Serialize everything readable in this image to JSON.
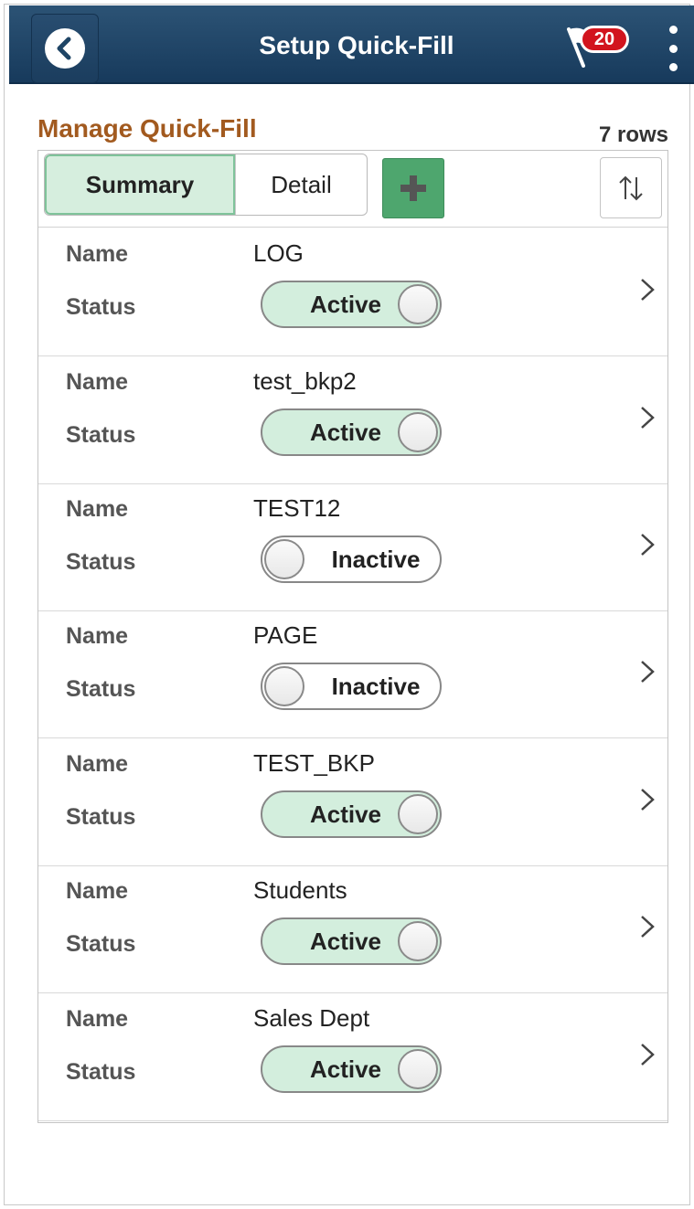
{
  "header": {
    "title": "Setup Quick-Fill",
    "notification_count": "20"
  },
  "section": {
    "title": "Manage Quick-Fill",
    "row_count": "7 rows"
  },
  "toolbar": {
    "view_tabs": [
      "Summary",
      "Detail"
    ],
    "selected_view": "Summary"
  },
  "labels": {
    "name": "Name",
    "status": "Status"
  },
  "rows": [
    {
      "name": "LOG",
      "status": "Active"
    },
    {
      "name": "test_bkp2",
      "status": "Active"
    },
    {
      "name": "TEST12",
      "status": "Inactive"
    },
    {
      "name": "PAGE",
      "status": "Inactive"
    },
    {
      "name": "TEST_BKP",
      "status": "Active"
    },
    {
      "name": "Students",
      "status": "Active"
    },
    {
      "name": "Sales Dept",
      "status": "Active"
    }
  ],
  "icons": {
    "back": "chevron-left-icon",
    "notifications": "flag-icon",
    "menu": "kebab-menu-icon",
    "add": "plus-icon",
    "sort": "sort-arrows-icon",
    "row_action": "chevron-right-icon"
  },
  "colors": {
    "header": "#1f4566",
    "section_title": "#a25a1f",
    "active_toggle": "#d3eedd",
    "add_button": "#4ea66e",
    "badge": "#d2141e"
  }
}
